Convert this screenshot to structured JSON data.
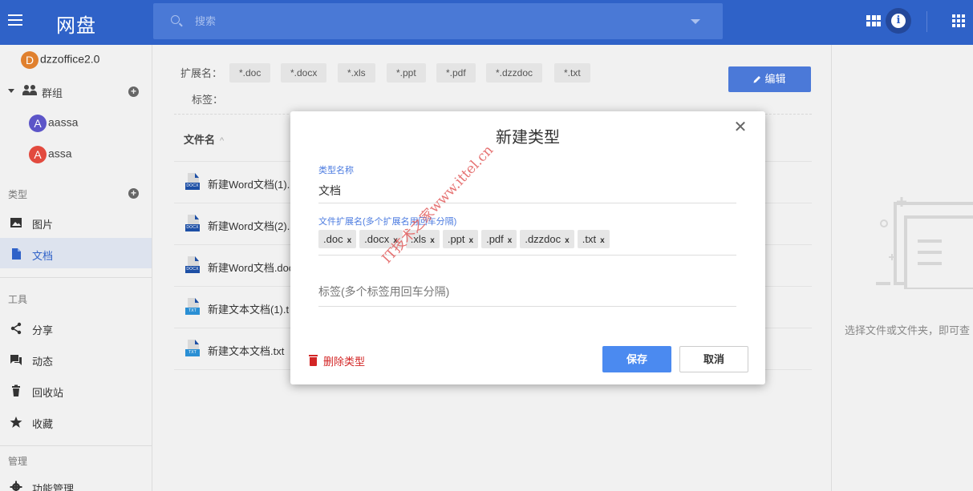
{
  "header": {
    "app_title": "网盘",
    "search_placeholder": "搜索"
  },
  "sidebar": {
    "user": {
      "avatar_letter": "D",
      "avatar_color": "#e0802e",
      "name": "dzzoffice2.0"
    },
    "groups_label": "群组",
    "members": [
      {
        "avatar_letter": "A",
        "avatar_color": "#5c55c8",
        "name": "aassa"
      },
      {
        "avatar_letter": "A",
        "avatar_color": "#e24a3e",
        "name": "assa"
      }
    ],
    "types_section": "类型",
    "type_items": [
      {
        "label": "图片",
        "active": false
      },
      {
        "label": "文档",
        "active": true
      }
    ],
    "tools_section": "工具",
    "tool_items": [
      {
        "label": "分享"
      },
      {
        "label": "动态"
      },
      {
        "label": "回收站"
      },
      {
        "label": "收藏"
      }
    ],
    "manage_section": "管理",
    "manage_items": [
      {
        "label": "功能管理"
      }
    ]
  },
  "main": {
    "ext_label": "扩展名：",
    "ext_chips": [
      "*.doc",
      "*.docx",
      "*.xls",
      "*.ppt",
      "*.pdf",
      "*.dzzdoc",
      "*.txt"
    ],
    "tags_label": "标签：",
    "edit_button": "编辑",
    "column_name": "文件名",
    "files": [
      {
        "name": "新建Word文档(1).",
        "type": "DOCX"
      },
      {
        "name": "新建Word文档(2).",
        "type": "DOCX"
      },
      {
        "name": "新建Word文档.doc",
        "type": "DOCX"
      },
      {
        "name": "新建文本文档(1).t",
        "type": "TXT"
      },
      {
        "name": "新建文本文档.txt",
        "type": "TXT"
      }
    ]
  },
  "right_panel": {
    "hint": "选择文件或文件夹，即可查"
  },
  "modal": {
    "title": "新建类型",
    "type_name_label": "类型名称",
    "type_name_value": "文档",
    "ext_label": "文件扩展名(多个扩展名用回车分隔)",
    "ext_chips": [
      ".doc",
      ".docx",
      ".xls",
      ".ppt",
      ".pdf",
      ".dzzdoc",
      ".txt"
    ],
    "tags_placeholder": "标签(多个标签用回车分隔)",
    "delete_label": "删除类型",
    "save_label": "保存",
    "cancel_label": "取消"
  },
  "watermark": "IT技术之家www.ittel.cn",
  "colors": {
    "header_bg": "#2f62c8",
    "primary_button": "#4b8af0",
    "danger": "#d32525",
    "active_nav_bg": "#dde3ee"
  }
}
